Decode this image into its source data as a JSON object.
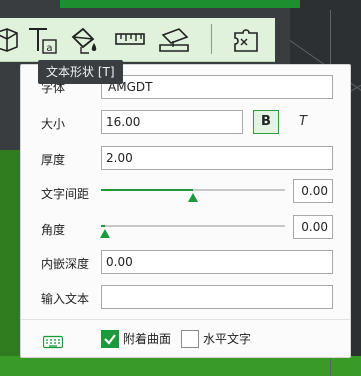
{
  "colors": {
    "accent": "#1a9a3a",
    "toolbar_bg": "#e1f2dc",
    "tooltip_bg": "#3b3e40"
  },
  "toolbar": {
    "tools": [
      "cube-icon",
      "text-shape-icon",
      "paint-bucket-icon",
      "ruler-icon",
      "surface-project-icon",
      "puzzle-icon"
    ]
  },
  "tooltip": {
    "text": "文本形状 [T]"
  },
  "panel": {
    "font_label": "字体",
    "font_value": "AMGDT",
    "size_label": "大小",
    "size_value": "16.00",
    "bold_label": "B",
    "italic_label": "T",
    "thickness_label": "厚度",
    "thickness_value": "2.00",
    "spacing_label": "文字间距",
    "spacing_value": "0.00",
    "spacing_slider_fraction": 0.5,
    "angle_label": "角度",
    "angle_value": "0.00",
    "angle_slider_fraction": 0.02,
    "inset_label": "内嵌深度",
    "inset_value": "0.00",
    "input_label": "输入文本",
    "input_value": "",
    "attach_surface_label": "附着曲面",
    "attach_surface_checked": true,
    "horizontal_text_label": "水平文字",
    "horizontal_text_checked": false,
    "keyboard_icon": "keyboard-icon"
  }
}
